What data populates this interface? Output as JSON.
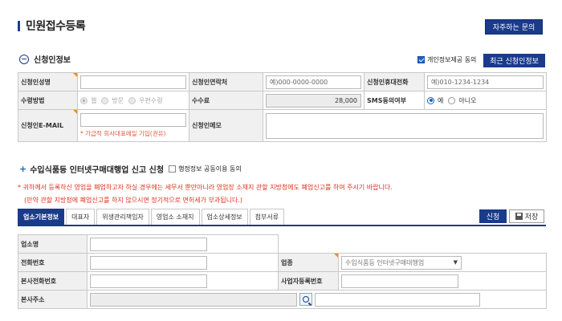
{
  "header": {
    "title": "민원접수등록",
    "faq_label": "자주하는 문의"
  },
  "applicant": {
    "section_title": "신청인정보",
    "privacy_consent": "개인정보제공 동의",
    "recent_button": "최근 신청인정보",
    "name_label": "신청인성명",
    "contact_label": "신청인연락처",
    "contact_placeholder": "예)000-0000-0000",
    "mobile_label": "신청인휴대전화",
    "mobile_placeholder": "예)010-1234-1234",
    "receive_label": "수령방법",
    "receive_options": [
      "웹",
      "방문",
      "우편수령"
    ],
    "fee_label": "수수료",
    "fee_value": "28,000",
    "sms_label": "SMS동의여부",
    "sms_options": [
      "예",
      "아니오"
    ],
    "email_label": "신청인E-MAIL",
    "email_hint": "* 가급적 회사대표메일 기입(권유)",
    "memo_label": "신청인메모"
  },
  "report": {
    "title": "수입식품등 인터넷구매대행업 신고 신청",
    "share_label": "행정정보 공동이용 동의",
    "notice_1": "* 귀하께서 등록하신 영업을 폐업하고자 하실 경우에는 세무서 뿐만아니라 영업장 소재지 관할 지방청에도 폐업신고를 하여 주시기 바랍니다.",
    "notice_2": "(만약 관할 지방청에 폐업신고를 하지 않으시면 정기적으로 면허세가 부과됩니다.)",
    "tabs": [
      "업소기본정보",
      "대표자",
      "위생관리책임자",
      "영업소 소재지",
      "업소상세정보",
      "첨부서류"
    ],
    "apply_button": "신청",
    "save_button": "저장"
  },
  "business": {
    "name_label": "업소명",
    "phone_label": "전화번호",
    "category_label": "업종",
    "category_value": "수입식품등 인터넷구매대행업",
    "hq_phone_label": "본사전화번호",
    "biz_no_label": "사업자등록번호",
    "hq_address_label": "본사주소"
  },
  "colors": {
    "primary": "#1a3a8a",
    "required_marker": "#f08c1e",
    "notice_red": "#e0311f"
  }
}
